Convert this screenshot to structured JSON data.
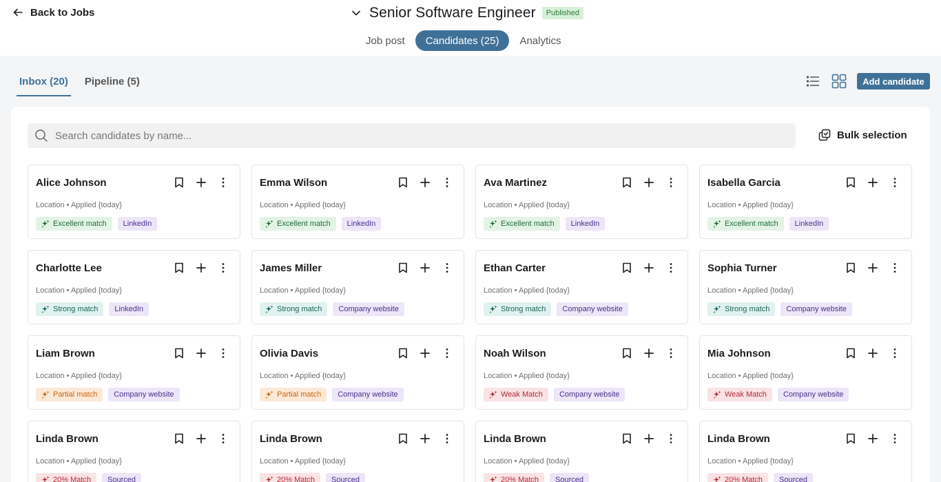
{
  "header": {
    "back_label": "Back to Jobs",
    "job_title": "Senior Software Engineer",
    "status": "Published"
  },
  "main_tabs": [
    {
      "label": "Job post",
      "active": false
    },
    {
      "label": "Candidates (25)",
      "active": true
    },
    {
      "label": "Analytics",
      "active": false
    }
  ],
  "sub_tabs": [
    {
      "label": "Inbox (20)",
      "active": true
    },
    {
      "label": "Pipeline (5)",
      "active": false
    }
  ],
  "toolbar": {
    "add_candidate_label": "Add candidate",
    "view_icons": [
      "list-view-icon",
      "grid-view-icon"
    ]
  },
  "search": {
    "placeholder": "Search candidates by name...",
    "value": ""
  },
  "bulk_selection_label": "Bulk selection",
  "match_styles": {
    "Excellent match": {
      "bg": "#e3f3e6",
      "fg": "#1f6b35"
    },
    "Strong match": {
      "bg": "#e0f2ef",
      "fg": "#1a6458"
    },
    "Partial match": {
      "bg": "#fde9d7",
      "fg": "#c9670f"
    },
    "Weak Match": {
      "bg": "#fbe2e4",
      "fg": "#b02a3a"
    },
    "20% Match": {
      "bg": "#fbe2e4",
      "fg": "#b02a3a"
    }
  },
  "source_style": {
    "bg": "#ece6f8",
    "fg": "#4a2f8a"
  },
  "candidates": [
    {
      "name": "Alice Johnson",
      "meta": "Location • Applied {today}",
      "match": "Excellent match",
      "source": "LinkedIn"
    },
    {
      "name": "Emma Wilson",
      "meta": "Location • Applied {today}",
      "match": "Excellent match",
      "source": "LinkedIn"
    },
    {
      "name": "Ava Martinez",
      "meta": "Location • Applied {today}",
      "match": "Excellent match",
      "source": "LinkedIn"
    },
    {
      "name": "Isabella Garcia",
      "meta": "Location • Applied {today}",
      "match": "Excellent match",
      "source": "LinkedIn"
    },
    {
      "name": "Charlotte Lee",
      "meta": "Location • Applied {today}",
      "match": "Strong match",
      "source": "LinkedIn"
    },
    {
      "name": "James Miller",
      "meta": "Location • Applied {today}",
      "match": "Strong match",
      "source": "Company website"
    },
    {
      "name": "Ethan Carter",
      "meta": "Location • Applied {today}",
      "match": "Strong match",
      "source": "Company website"
    },
    {
      "name": "Sophia Turner",
      "meta": "Location • Applied {today}",
      "match": "Strong match",
      "source": "Company website"
    },
    {
      "name": "Liam Brown",
      "meta": "Location • Applied {today}",
      "match": "Partial match",
      "source": "Company website"
    },
    {
      "name": "Olivia Davis",
      "meta": "Location • Applied {today}",
      "match": "Partial match",
      "source": "Company website"
    },
    {
      "name": "Noah Wilson",
      "meta": "Location • Applied {today}",
      "match": "Weak Match",
      "source": "Company website"
    },
    {
      "name": "Mia Johnson",
      "meta": "Location • Applied {today}",
      "match": "Weak Match",
      "source": "Company website"
    },
    {
      "name": "Linda Brown",
      "meta": "Location • Applied {today}",
      "match": "20% Match",
      "source": "Sourced"
    },
    {
      "name": "Linda Brown",
      "meta": "Location • Applied {today}",
      "match": "20% Match",
      "source": "Sourced"
    },
    {
      "name": "Linda Brown",
      "meta": "Location • Applied {today}",
      "match": "20% Match",
      "source": "Sourced"
    },
    {
      "name": "Linda Brown",
      "meta": "Location • Applied {today}",
      "match": "20% Match",
      "source": "Sourced"
    }
  ]
}
